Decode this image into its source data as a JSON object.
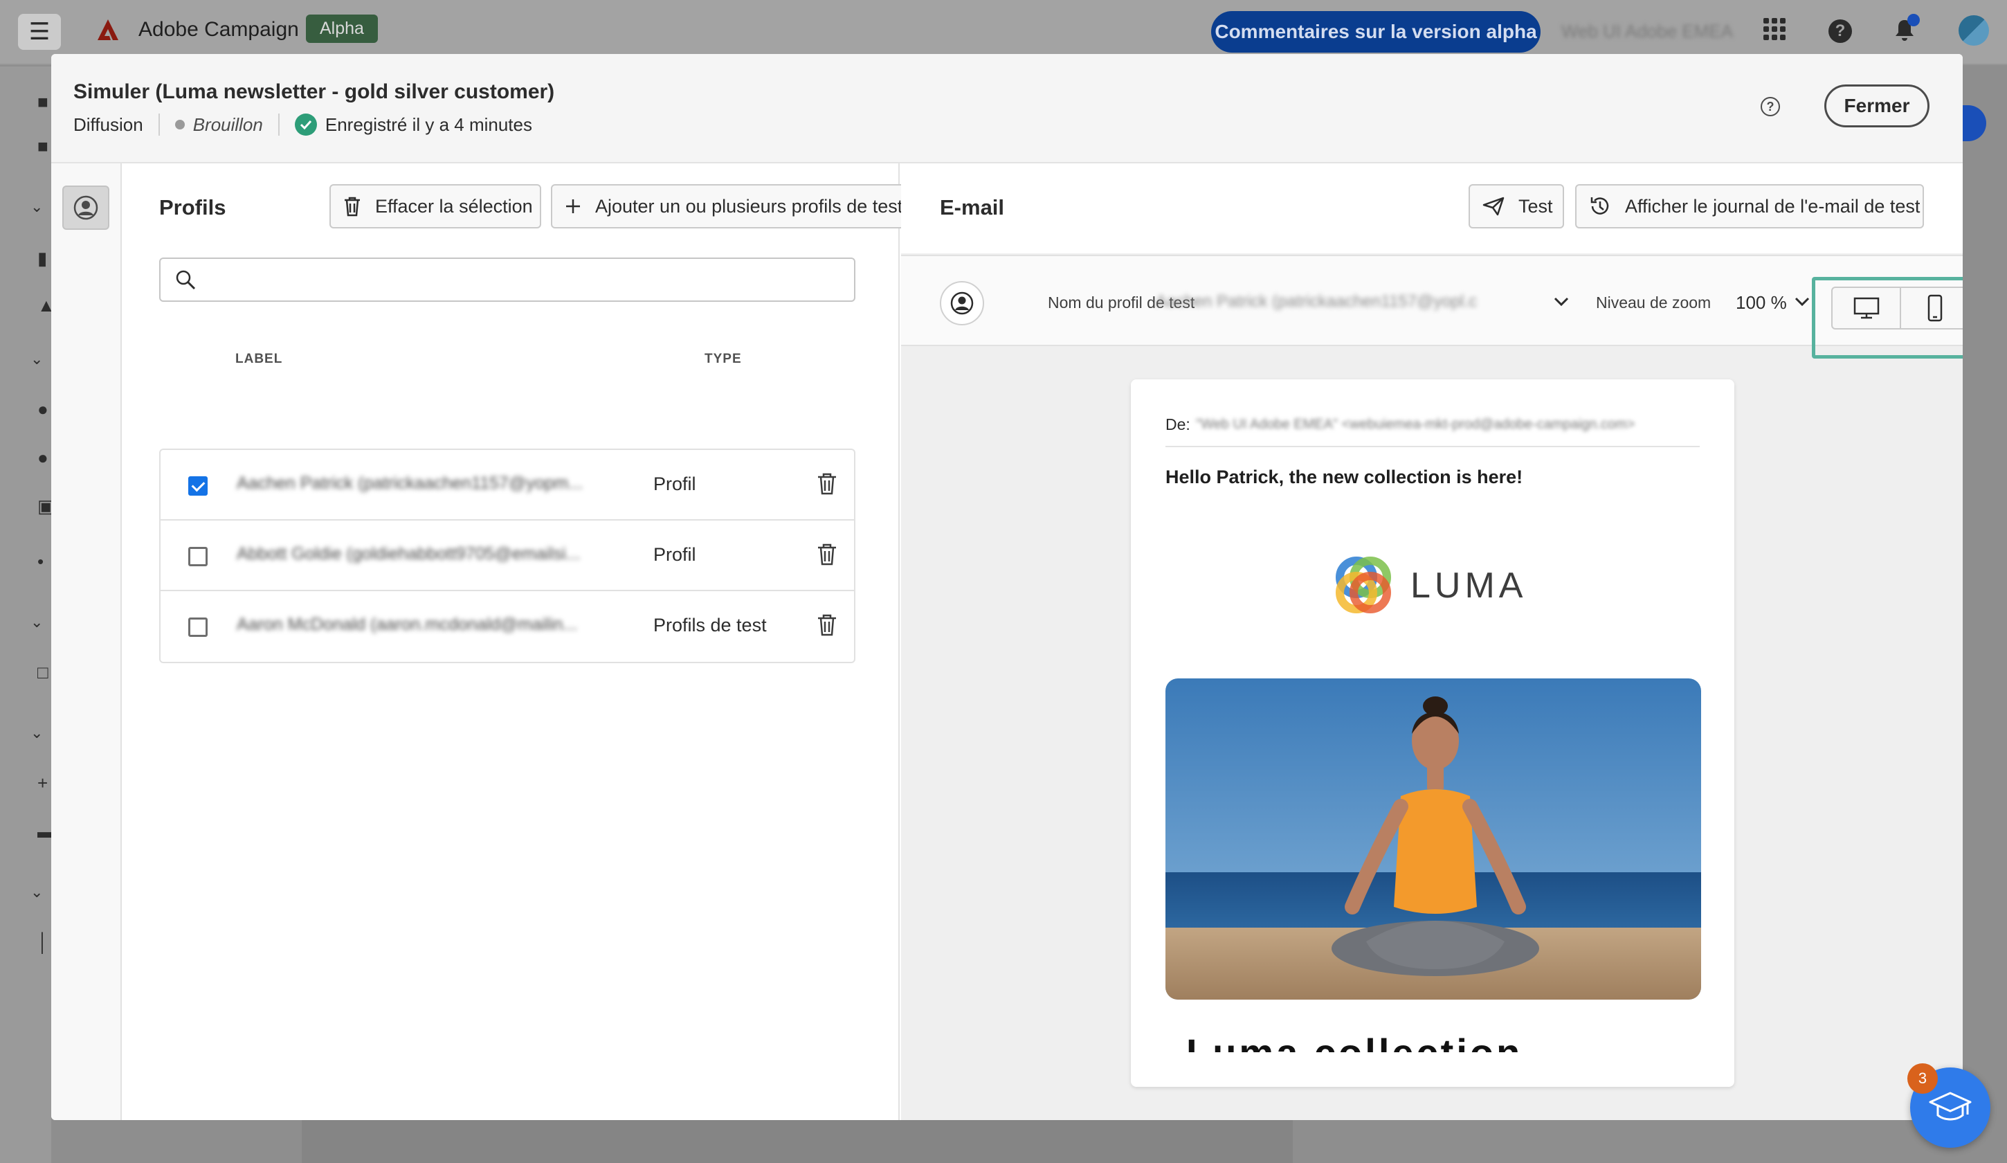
{
  "app": {
    "name": "Adobe Campaign",
    "badge": "Alpha",
    "feedback_label": "Commentaires sur la version alpha",
    "org_name": "Web UI Adobe EMEA"
  },
  "modal": {
    "title": "Simuler (Luma newsletter - gold silver customer)",
    "type_label": "Diffusion",
    "status": "Brouillon",
    "saved_text": "Enregistré il y a 4 minutes",
    "close_label": "Fermer"
  },
  "profiles": {
    "title": "Profils",
    "clear_label": "Effacer la sélection",
    "add_label": "Ajouter un ou plusieurs profils de test",
    "search_placeholder": "",
    "columns": {
      "label": "LABEL",
      "type": "TYPE"
    },
    "rows": [
      {
        "label": "Aachen Patrick (patrickaachen1157@yopm...",
        "type": "Profil",
        "checked": true
      },
      {
        "label": "Abbott Goldie (goldiehabbott9705@emailsi...",
        "type": "Profil",
        "checked": false
      },
      {
        "label": "Aaron McDonald (aaron.mcdonald@mailin...",
        "type": "Profils de test",
        "checked": false
      }
    ]
  },
  "email": {
    "title": "E-mail",
    "test_label": "Test",
    "log_label": "Afficher le journal de l'e-mail de test",
    "profile_label": "Nom du profil de test",
    "profile_value": "Aachen Patrick (patrickaachen1157@yopl.c",
    "zoom_label": "Niveau de zoom",
    "zoom_value": "100 %",
    "from_label": "De:",
    "from_value": "\"Web UI Adobe EMEA\" <webuiemea-mkt-prod@adobe-campaign.com>",
    "subject": "Hello Patrick, the new collection is here!",
    "brand": "LUMA",
    "headline": "Luma collection"
  },
  "learn": {
    "count": "3"
  }
}
